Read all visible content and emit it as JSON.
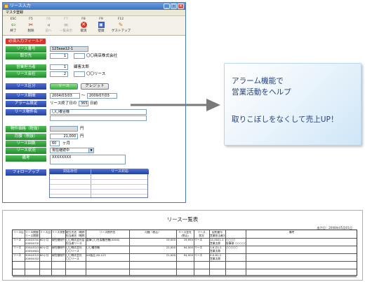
{
  "window": {
    "title": "リース入力",
    "menu_title": "マスタ登録"
  },
  "toolbar": [
    {
      "key": "ESC",
      "label": "終了",
      "icon": "door-exit-icon",
      "disabled": false
    },
    {
      "key": "F5",
      "label": "削除",
      "icon": "delete-icon",
      "disabled": false
    },
    {
      "key": "F6",
      "label": "前へ",
      "icon": "prev-icon",
      "disabled": true
    },
    {
      "key": "F7",
      "label": "一覧表示",
      "icon": "list-icon",
      "disabled": true
    },
    {
      "key": "F8",
      "label": "取消",
      "icon": "cancel-icon",
      "disabled": false
    },
    {
      "key": "F9",
      "label": "登録",
      "icon": "save-icon",
      "disabled": false
    },
    {
      "key": "F12",
      "label": "ゲストアップ",
      "icon": "pen-icon",
      "disabled": false
    }
  ],
  "form": {
    "section_label": "必須入力フィールド",
    "lease_no": {
      "label": "リース番号",
      "value": "123aaa12-1"
    },
    "client": {
      "label": "取引先",
      "code": "1",
      "name": "〇〇商店株式会社"
    },
    "sales_rep": {
      "label": "営業担当者",
      "code": "1",
      "name": "顧客太郎"
    },
    "lease_company": {
      "label": "リース会社",
      "code": "2",
      "name": "〇〇リース"
    },
    "lease_type": {
      "label": "リース区分",
      "option_lease": "リース",
      "option_credit": "クレジット"
    },
    "lease_period": {
      "label": "リース期間",
      "start": "2004/03/03",
      "separator": "～",
      "end": "2009/07/03"
    },
    "alarm": {
      "label": "アラーム設定",
      "prefix": "リース終了日の",
      "days": "365",
      "suffix": "日前"
    },
    "lease_item": {
      "label": "リース物件名",
      "value": "〇〇複合機"
    },
    "total_price": {
      "label": "物件価格（税抜）",
      "unit": "円"
    },
    "monthly": {
      "label": "月額（税抜）",
      "value": "21,000",
      "unit": "円"
    },
    "count": {
      "label": "リース回数",
      "value": "60",
      "unit": "ヶ月"
    },
    "status": {
      "label": "リース状況",
      "value": "現在継続中"
    },
    "remarks": {
      "label": "備考",
      "value": "XXXXXXXX"
    },
    "followup": {
      "label": "フォローアップ",
      "col_date": "対応日付",
      "col_content": "リース対応"
    }
  },
  "callout": {
    "line1": "アラーム機能で",
    "line2": "営業活動をヘルプ",
    "line3": "取りこぼしをなくして売上UP！"
  },
  "report": {
    "title": "リース一覧表",
    "print_date": "出力日：2008年05月01日",
    "headers": [
      "リース区分",
      "リース期間(自)\nリース期間(至)",
      "リース回数",
      "リース状態",
      "取引先名（略称）\n担当者名（略称）",
      "リース物件名",
      "月額（税込）",
      "リース会社\n(税込)",
      "リース\n状況",
      "契約番号\n営業担当者名",
      "備考"
    ],
    "rows": [
      [
        "リース",
        "2004/03/03\n2009/07/03",
        "60ヶ月",
        "現在継続中",
        "〇〇株式会社店\n担当者リース",
        "倉庫〇〇社製複合機(XXXX)",
        "19,000",
        "19,950",
        "リース",
        "14-0021-1\n営業太郎",
        "○○○○\n仮事務 ○○○○○"
      ],
      [
        "リース",
        "2004/02/15\n2009/06/20",
        "60ヶ月",
        "現在継続中",
        "〇〇株式会社\n〇〇リース",
        "〇〇複合機",
        "21,000",
        "94,000",
        "リース",
        "1-6-(2)-1\n営業太郎",
        "○○○○○"
      ],
      [
        "リース",
        "2004/01/20\n2009/03/20",
        "60ヶ月",
        "現在継続中",
        "〇〇株式会社\n〇〇リース",
        "XX製品 XX-123",
        "21,000",
        "94,000",
        "リース",
        "0-0-81-1\n営業太郎",
        ""
      ]
    ]
  },
  "colors": {
    "label_green": "#2f9e3a",
    "label_blue": "#2c4fb8",
    "section_red": "#d9342b",
    "callout_text": "#24407a",
    "arrow": "#7a7a7a"
  }
}
